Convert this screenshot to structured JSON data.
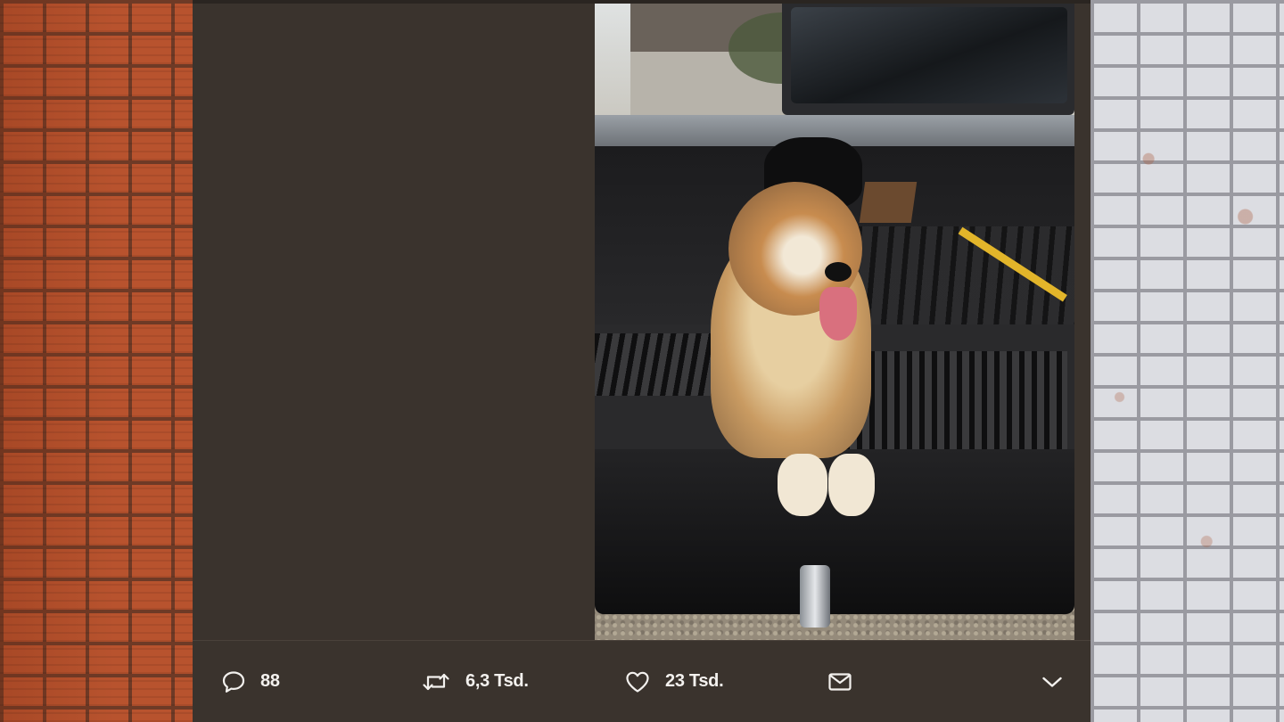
{
  "tweet": {
    "photo_alt": "",
    "actions": {
      "reply": {
        "icon": "speech-bubble-icon",
        "count": "88"
      },
      "retweet": {
        "icon": "retweet-icon",
        "count": "6,3 Tsd."
      },
      "like": {
        "icon": "heart-icon",
        "count": "23 Tsd."
      },
      "message": {
        "icon": "envelope-icon"
      },
      "more": {
        "icon": "chevron-down-icon"
      }
    }
  },
  "colors": {
    "card_background": "#3a332d",
    "text": "#f3f1ee",
    "left_wall": "#b8532e",
    "right_wall": "#dcdde2"
  }
}
